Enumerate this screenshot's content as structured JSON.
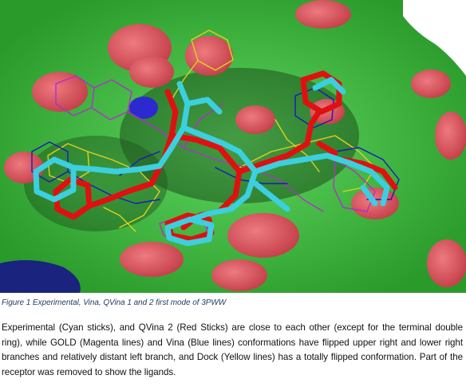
{
  "figure": {
    "image_description_icon": "molecular-docking-render",
    "colors": {
      "surface_green": "#3cbb3c",
      "surface_red": "#d9505a",
      "cyan_sticks": "#3ccfe0",
      "red_sticks": "#e01010",
      "magenta_lines": "#b030c8",
      "blue_lines": "#1a1ab8",
      "yellow_lines": "#e0d020",
      "dark_blue_patch": "#1a237e"
    }
  },
  "caption": "Figure 1 Experimental, Vina, QVina 1 and 2 first mode of 3PWW",
  "body": "Experimental (Cyan sticks), and QVina 2 (Red Sticks) are close to each other (except for the terminal double ring), while GOLD (Magenta lines) and Vina (Blue lines) conformations have flipped upper right and lower right branches and relatively distant left branch, and Dock (Yellow lines) has a totally flipped conformation. Part of the receptor was removed to show the ligands."
}
